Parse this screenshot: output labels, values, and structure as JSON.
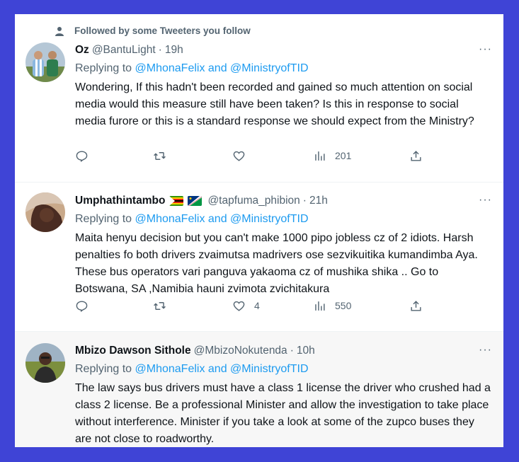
{
  "tweets": [
    {
      "social_context": "Followed by some Tweeters you follow",
      "name": "Oz",
      "handle": "@BantuLight",
      "dot": "·",
      "time": "19h",
      "replying_prefix": "Replying to",
      "replying_users": "@MhonaFelix and @MinistryofTID",
      "text": "Wondering, If this hadn't been recorded and gained so much attention on social media would this measure still have been taken? Is this in response to social media furore or this is a standard response we should expect from the Ministry?",
      "reply_count": "",
      "retweet_count": "",
      "like_count": "",
      "views": "201",
      "more": "···"
    },
    {
      "name": "Umphathintambo",
      "handle": "@tapfuma_phibion",
      "dot": "·",
      "time": "21h",
      "replying_prefix": "Replying to",
      "replying_users": "@MhonaFelix and @MinistryofTID",
      "text": "Maita henyu decision but you can't make 1000 pipo jobless cz of 2 idiots. Harsh penalties fo both drivers zvaimutsa madrivers ose sezvikuitika kumandimba Aya. These bus operators vari panguva yakaoma cz of mushika shika .. Go to Botswana, SA ,Namibia hauni zvimota zvichitakura",
      "reply_count": "",
      "retweet_count": "",
      "like_count": "4",
      "views": "550",
      "flags": [
        "zimbabwe-flag",
        "namibia-flag"
      ],
      "more": "···"
    },
    {
      "name": "Mbizo Dawson Sithole",
      "handle": "@MbizoNokutenda",
      "dot": "·",
      "time": "10h",
      "replying_prefix": "Replying to",
      "replying_users": "@MhonaFelix and @MinistryofTID",
      "text": "The law says bus drivers must have a class 1 license the driver who crushed had a class 2 license.  Be a professional Minister and allow the investigation to take place without interference.  Minister if you take a look at some of the zupco buses they are not close to roadworthy.",
      "more": "···"
    }
  ],
  "colors": {
    "background": "#3f44d6",
    "link": "#1d9bf0",
    "muted": "#536471",
    "text": "#0f1419"
  },
  "icons": [
    "person-icon",
    "reply-icon",
    "retweet-icon",
    "like-icon",
    "views-icon",
    "share-icon",
    "more-icon"
  ]
}
